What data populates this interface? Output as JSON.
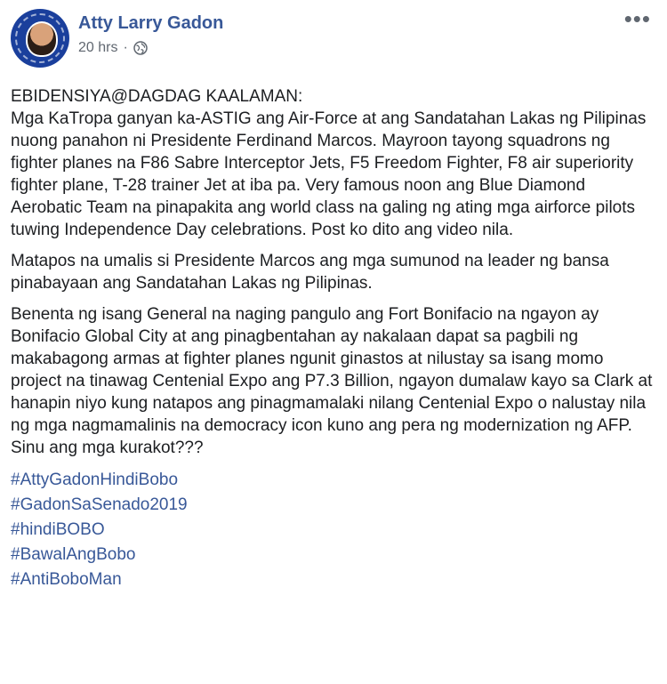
{
  "post": {
    "author": "Atty Larry Gadon",
    "timestamp": "20 hrs",
    "separator": "·",
    "privacy_icon": "globe-icon",
    "more_icon": "•••",
    "paragraphs": [
      "EBIDENSIYA@DAGDAG KAALAMAN:\nMga KaTropa ganyan ka-ASTIG ang Air-Force at ang Sandatahan Lakas ng Pilipinas nuong panahon ni Presidente Ferdinand Marcos. Mayroon tayong squadrons ng fighter planes na F86 Sabre Interceptor Jets, F5 Freedom Fighter, F8 air superiority fighter plane, T-28 trainer Jet at iba pa. Very famous noon ang Blue Diamond Aerobatic Team na pinapakita ang world class na galing ng ating mga airforce pilots tuwing Independence Day celebrations. Post ko dito ang video nila.",
      "Matapos na umalis si Presidente Marcos ang mga sumunod na leader ng bansa pinabayaan ang Sandatahan Lakas ng Pilipinas.",
      "Benenta ng isang General na naging pangulo ang Fort Bonifacio na ngayon ay Bonifacio Global City at ang pinagbentahan ay nakalaan dapat sa pagbili ng makabagong armas at fighter planes ngunit ginastos at nilustay sa isang momo project na tinawag Centenial Expo ang P7.3 Billion, ngayon dumalaw kayo sa Clark at hanapin niyo kung natapos ang pinagmamalaki nilang Centenial Expo o nalustay nila ng mga nagmamalinis na democracy icon kuno ang pera ng modernization ng AFP.\nSinu ang mga kurakot???"
    ],
    "hashtags": [
      "#AttyGadonHindiBobo",
      "#GadonSaSenado2019",
      "#hindiBOBO",
      "#BawalAngBobo",
      "#AntiBoboMan"
    ]
  },
  "colors": {
    "link_blue": "#385898",
    "text": "#1c1e21",
    "meta_gray": "#606770"
  }
}
